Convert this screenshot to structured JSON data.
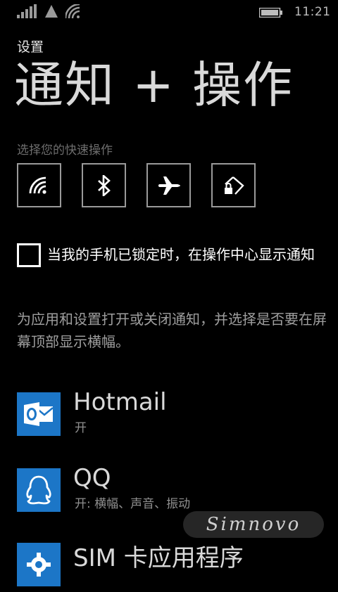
{
  "status_bar": {
    "time": "11:21",
    "icons": [
      "signal-icon",
      "network-triangle-icon",
      "wifi-icon",
      "battery-icon"
    ]
  },
  "header": {
    "app_title": "设置",
    "page_title": "通知 + 操作"
  },
  "quick_actions": {
    "label": "选择您的快速操作",
    "tiles": [
      {
        "icon": "wifi-icon"
      },
      {
        "icon": "bluetooth-icon"
      },
      {
        "icon": "airplane-mode-icon"
      },
      {
        "icon": "rotation-lock-icon"
      }
    ]
  },
  "lock_screen_option": {
    "checked": false,
    "label": "当我的手机已锁定时，在操作中心显示通知"
  },
  "description": "为应用和设置打开或关闭通知，并选择是否要在屏幕顶部显示横幅。",
  "apps": [
    {
      "name": "Hotmail",
      "status": "开",
      "icon": "outlook-icon",
      "tile_color": "#1c76c7"
    },
    {
      "name": "QQ",
      "status": "开: 横幅、声音、振动",
      "icon": "qq-icon",
      "tile_color": "#1c76c7"
    },
    {
      "name": "SIM 卡应用程序",
      "status": "",
      "icon": "gear-icon",
      "tile_color": "#1c76c7"
    }
  ],
  "watermark": "Simnovo"
}
